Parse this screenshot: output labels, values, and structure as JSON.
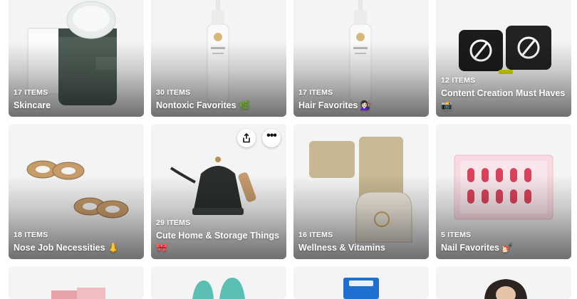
{
  "lists": [
    {
      "count": "17 ITEMS",
      "title": "Skincare",
      "emoji": "",
      "image": "skincare-pads-jar"
    },
    {
      "count": "30 ITEMS",
      "title": "Nontoxic Favorites",
      "emoji": "🌿",
      "image": "pump-bottle"
    },
    {
      "count": "17 ITEMS",
      "title": "Hair Favorites",
      "emoji": "💇🏻‍♀️",
      "image": "pump-bottle"
    },
    {
      "count": "12 ITEMS",
      "title": "Content Creation Must Haves",
      "emoji": "📸",
      "image": "wireless-mics"
    },
    {
      "count": "18 ITEMS",
      "title": "Nose Job Necessities",
      "emoji": "👃",
      "image": "tape-rolls"
    },
    {
      "count": "29 ITEMS",
      "title": "Cute Home & Storage Things",
      "emoji": "🎀",
      "image": "gooseneck-kettle"
    },
    {
      "count": "16 ITEMS",
      "title": "Wellness & Vitamins",
      "emoji": "",
      "image": "acupressure-mat"
    },
    {
      "count": "5 ITEMS",
      "title": "Nail Favorites",
      "emoji": "💅🏻",
      "image": "press-on-nails"
    },
    {
      "count": "",
      "title": "",
      "emoji": "",
      "image": "pink-box"
    },
    {
      "count": "",
      "title": "",
      "emoji": "",
      "image": "teal-gloves"
    },
    {
      "count": "",
      "title": "",
      "emoji": "",
      "image": "blue-package"
    },
    {
      "count": "",
      "title": "",
      "emoji": "",
      "image": "person-portrait"
    }
  ],
  "card_actions": {
    "share_icon": "share-icon",
    "more_icon": "more-options-icon",
    "more_glyph": "•••"
  },
  "colors": {
    "card_bg": "#f3f3f3",
    "text_on_card": "#ffffff",
    "overlay_btn": "#ffffff"
  }
}
